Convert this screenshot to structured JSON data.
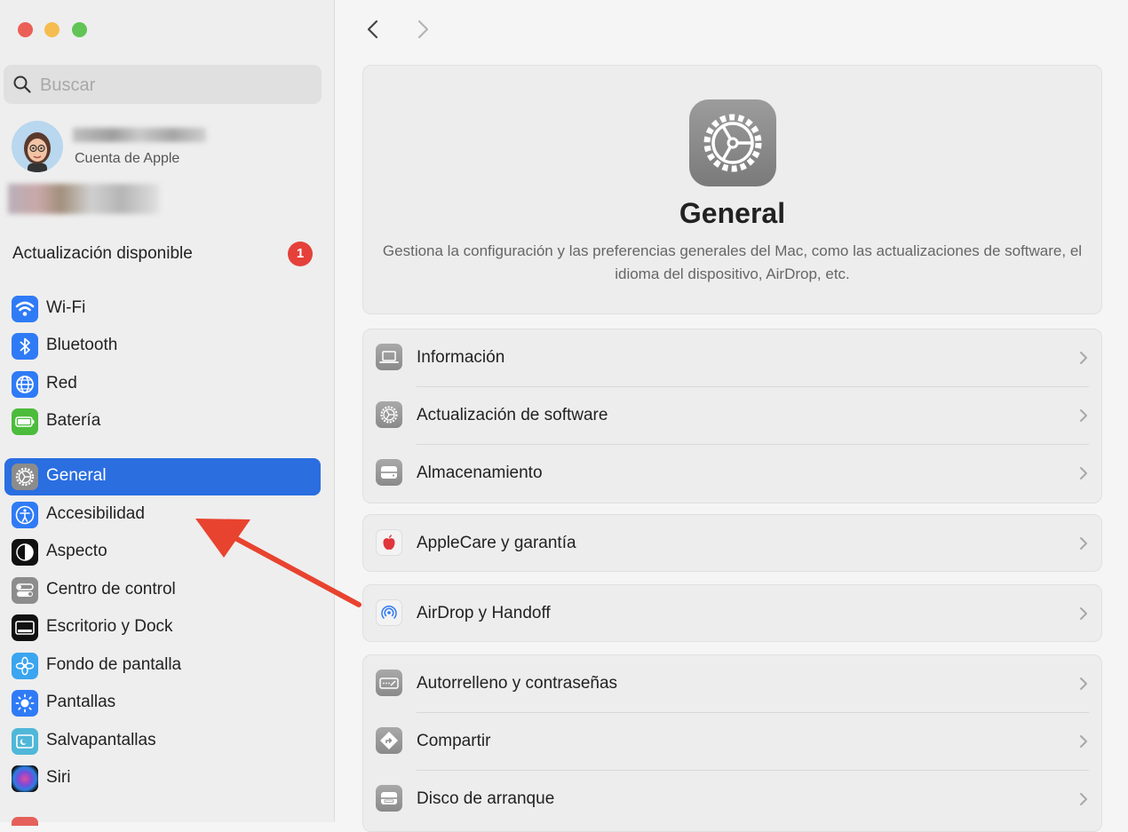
{
  "window": {
    "buttons": [
      "close",
      "minimize",
      "zoom"
    ],
    "colors": {
      "close": "#ec5f56",
      "minimize": "#f5bd4f",
      "zoom": "#61c454"
    }
  },
  "search": {
    "placeholder": "Buscar"
  },
  "account": {
    "subtitle": "Cuenta de Apple"
  },
  "update": {
    "label": "Actualización disponible",
    "badge": "1"
  },
  "sidebar": {
    "items": [
      {
        "label": "Wi-Fi",
        "icon": "wifi-icon",
        "color": "#2f7bf6"
      },
      {
        "label": "Bluetooth",
        "icon": "bluetooth-icon",
        "color": "#2f7bf6"
      },
      {
        "label": "Red",
        "icon": "globe-icon",
        "color": "#2f7bf6"
      },
      {
        "label": "Batería",
        "icon": "battery-icon",
        "color": "#4cbc3c"
      },
      {
        "label": "General",
        "icon": "gear-icon",
        "color": "#8c8c8c",
        "selected": true
      },
      {
        "label": "Accesibilidad",
        "icon": "accessibility-icon",
        "color": "#2f7bf6"
      },
      {
        "label": "Aspecto",
        "icon": "appearance-icon",
        "color": "#111111"
      },
      {
        "label": "Centro de control",
        "icon": "control-center-icon",
        "color": "#8c8c8c"
      },
      {
        "label": "Escritorio y Dock",
        "icon": "dock-icon",
        "color": "#111111"
      },
      {
        "label": "Fondo de pantalla",
        "icon": "wallpaper-icon",
        "color": "#3aa5f0"
      },
      {
        "label": "Pantallas",
        "icon": "displays-icon",
        "color": "#2f7bf6"
      },
      {
        "label": "Salvapantallas",
        "icon": "screensaver-icon",
        "color": "#4fb7d8"
      },
      {
        "label": "Siri",
        "icon": "siri-icon",
        "color": "#222222"
      }
    ],
    "accent": "#2a6ee0"
  },
  "main": {
    "hero": {
      "title": "General",
      "description": "Gestiona la configuración y las preferencias generales del Mac, como las actualizaciones de software, el idioma del dispositivo, AirDrop, etc."
    },
    "groups": [
      [
        {
          "label": "Información",
          "icon": "laptop-icon"
        },
        {
          "label": "Actualización de software",
          "icon": "software-update-icon"
        },
        {
          "label": "Almacenamiento",
          "icon": "storage-icon"
        }
      ],
      [
        {
          "label": "AppleCare y garantía",
          "icon": "apple-icon"
        }
      ],
      [
        {
          "label": "AirDrop y Handoff",
          "icon": "airdrop-icon"
        }
      ],
      [
        {
          "label": "Autorrelleno y contraseñas",
          "icon": "autofill-icon"
        },
        {
          "label": "Compartir",
          "icon": "sharing-icon"
        },
        {
          "label": "Disco de arranque",
          "icon": "startup-disk-icon"
        }
      ]
    ]
  },
  "annotation": {
    "arrow_color": "#e8432e"
  }
}
